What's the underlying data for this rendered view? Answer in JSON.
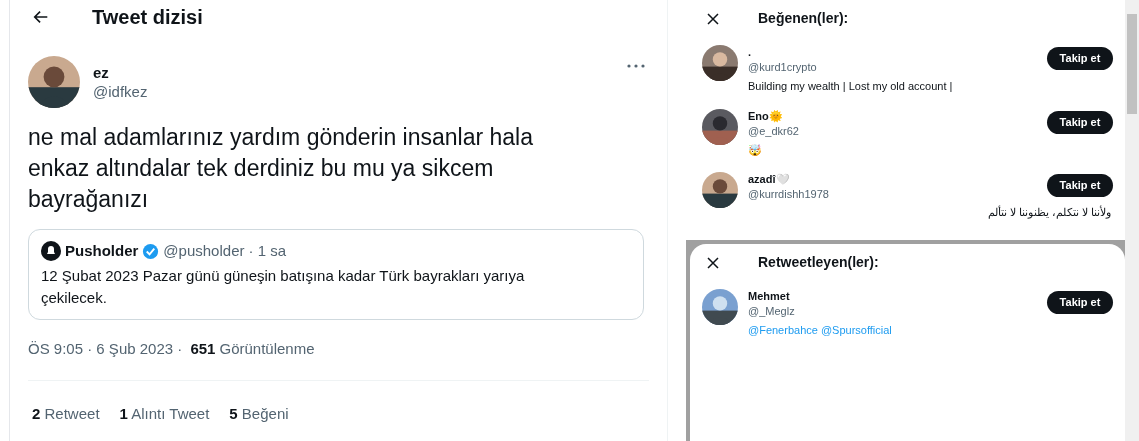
{
  "thread": {
    "title": "Tweet dizisi",
    "tweet": {
      "name": "ez",
      "handle": "@idfkez",
      "text": "ne mal adamlarınız yardım gönderin insanlar hala enkaz altındalar tek derdiniz bu mu ya sikcem bayrağanızı",
      "quote": {
        "name": "Pusholder",
        "verified": true,
        "handle": "@pusholder",
        "time": "· 1 sa",
        "text": "12 Şubat 2023 Pazar günü güneşin batışına kadar Türk bayrakları yarıya çekilecek."
      },
      "meta": "ÖS 9:05 · 6 Şub 2023 · ",
      "views_count": "651",
      "views_label": "Görüntülenme",
      "stats": [
        {
          "count": "2",
          "label": "Retweet"
        },
        {
          "count": "1",
          "label": "Alıntı Tweet"
        },
        {
          "count": "5",
          "label": "Beğeni"
        }
      ]
    }
  },
  "panels": [
    {
      "title": "Beğenen(ler):",
      "users": [
        {
          "name": ".",
          "handle": "@kurd1crypto",
          "bio": "Building my wealth | Lost my old account |",
          "kind": "text",
          "button": "Takip et"
        },
        {
          "name": "Eno🌞",
          "handle": "@e_dkr62",
          "bio": "🤯",
          "kind": "text",
          "button": "Takip et"
        },
        {
          "name": "azadî🤍",
          "handle": "@kurrdishh1978",
          "bio": "ولأننا لا نتكلم، يظنوننا لا نتألم",
          "kind": "rtl",
          "button": "Takip et"
        }
      ]
    },
    {
      "title": "Retweetleyen(ler):",
      "users": [
        {
          "name": "Mehmet",
          "handle": "@_Meglz",
          "bio": "@Fenerbahce @Spursofficial",
          "kind": "link",
          "button": "Takip et"
        }
      ]
    }
  ]
}
